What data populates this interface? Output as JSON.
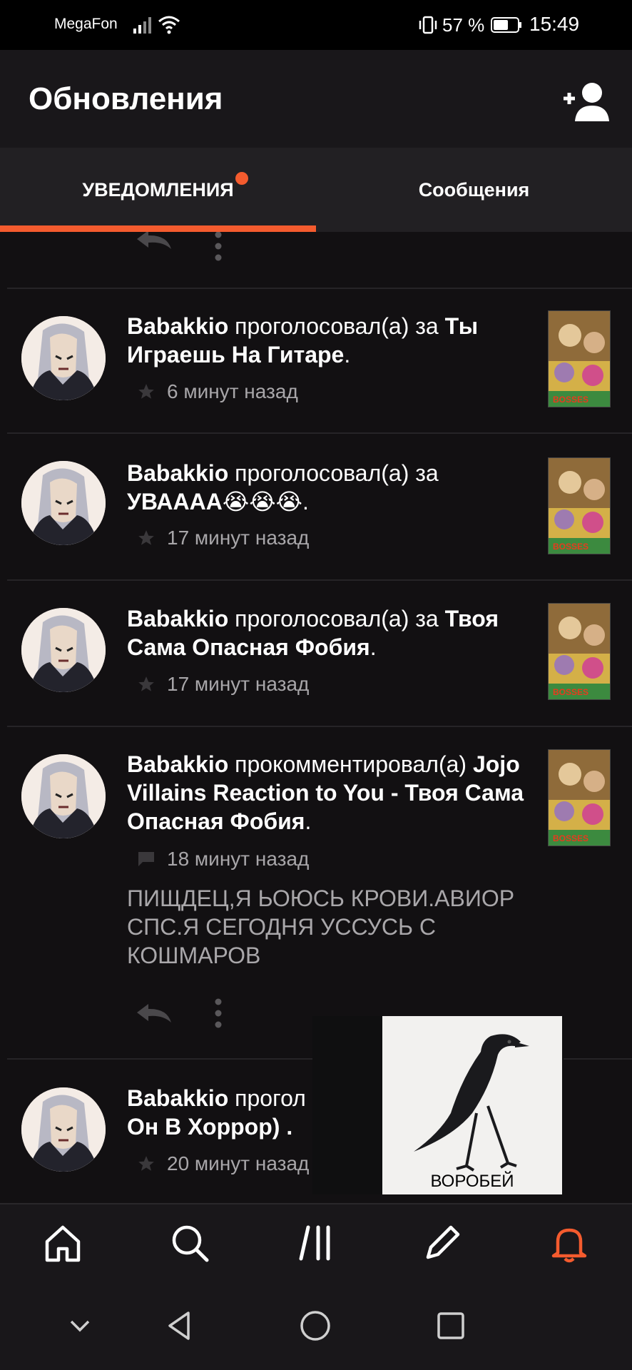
{
  "status": {
    "carrier": "MegaFon",
    "battery": "57 %",
    "time": "15:49"
  },
  "header": {
    "title": "Обновления"
  },
  "tabs": [
    {
      "label": "УВЕДОМЛЕНИЯ",
      "active": true,
      "has_dot": true
    },
    {
      "label": "Сообщения",
      "active": false
    }
  ],
  "notifications": [
    {
      "user": "Babakkio",
      "action": "проголосовал(а) за",
      "target": "Ты Играешь На Гитаре",
      "time": "6 минут назад",
      "icon": "star-icon"
    },
    {
      "user": "Babakkio",
      "action": "проголосовал(а) за",
      "target": "УВАААА😭😭😭",
      "time": "17 минут назад",
      "icon": "star-icon"
    },
    {
      "user": "Babakkio",
      "action": "проголосовал(а) за",
      "target": "Твоя Сама Опасная Фобия",
      "time": "17 минут назад",
      "icon": "star-icon"
    },
    {
      "user": "Babakkio",
      "action": "прокомментировал(а)",
      "target": "Jojo Villains Reaction to You - Твоя Сама Опасная Фобия",
      "time": "18 минут назад",
      "icon": "comment-icon",
      "comment": "ПИЩДЕЦ,Я ЬОЮСЬ КРОВИ.АВИОР СПС.Я СЕГОДНЯ УССУСЬ С КОШМАРОВ"
    },
    {
      "user": "Babakkio",
      "action": "прогол",
      "target": "Он В Хоррор) .",
      "time": "20 минут назад",
      "icon": "star-icon"
    }
  ],
  "popup": {
    "label": "ВОРОБЕЙ"
  },
  "bottom_nav": [
    {
      "icon": "home-icon"
    },
    {
      "icon": "search-icon"
    },
    {
      "icon": "library-icon"
    },
    {
      "icon": "pencil-icon"
    },
    {
      "icon": "bell-icon",
      "active": true
    }
  ],
  "colors": {
    "accent": "#f45b2e",
    "background": "#121012"
  }
}
